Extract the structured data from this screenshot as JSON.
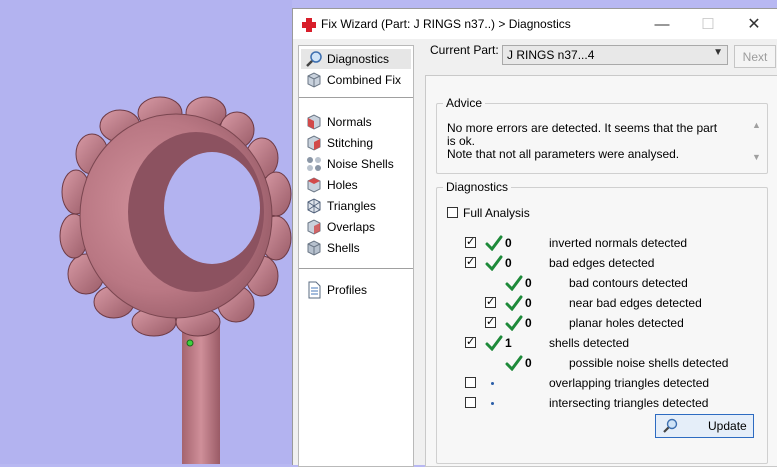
{
  "dialog": {
    "title": "Fix Wizard (Part: J RINGS n37..) > Diagnostics",
    "controls": {
      "minimize": "—",
      "maximize": "☐",
      "close": "✕"
    }
  },
  "nav": {
    "items": [
      {
        "label": "Diagnostics",
        "icon": "magnifier-icon",
        "selected": true
      },
      {
        "label": "Combined Fix",
        "icon": "cube-icon"
      },
      {
        "label": "Normals",
        "icon": "normals-cube-icon"
      },
      {
        "label": "Stitching",
        "icon": "stitching-cube-icon"
      },
      {
        "label": "Noise Shells",
        "icon": "noise-shells-icon"
      },
      {
        "label": "Holes",
        "icon": "holes-cube-icon"
      },
      {
        "label": "Triangles",
        "icon": "triangles-icon"
      },
      {
        "label": "Overlaps",
        "icon": "overlaps-cube-icon"
      },
      {
        "label": "Shells",
        "icon": "shells-cube-icon"
      },
      {
        "label": "Profiles",
        "icon": "document-icon"
      }
    ]
  },
  "current_part": {
    "label": "Current Part:",
    "value": "J RINGS n37...4"
  },
  "next_label": "Next",
  "advice": {
    "legend": "Advice",
    "line1": "No more errors are detected. It seems that the part is ok.",
    "line2": "Note that not all parameters were analysed."
  },
  "diagnostics": {
    "legend": "Diagnostics",
    "full_analysis_label": "Full Analysis",
    "full_analysis_checked": false,
    "rows": [
      {
        "checkbox": true,
        "checked": true,
        "status": "ok",
        "count": "0",
        "label": "inverted normals detected"
      },
      {
        "checkbox": true,
        "checked": true,
        "status": "ok",
        "count": "0",
        "label": "bad edges detected"
      },
      {
        "checkbox": false,
        "status": "ok",
        "count": "0",
        "label": "bad contours detected"
      },
      {
        "checkbox": true,
        "checked": true,
        "status": "ok",
        "count": "0",
        "label": "near bad edges detected"
      },
      {
        "checkbox": true,
        "checked": true,
        "status": "ok",
        "count": "0",
        "label": "planar holes detected"
      },
      {
        "checkbox": true,
        "checked": true,
        "status": "ok",
        "count": "1",
        "label": "shells detected"
      },
      {
        "checkbox": false,
        "status": "ok",
        "count": "0",
        "label": "possible noise shells detected"
      },
      {
        "checkbox": true,
        "checked": false,
        "status": "not-run",
        "count": "",
        "label": "overlapping triangles detected"
      },
      {
        "checkbox": true,
        "checked": false,
        "status": "not-run",
        "count": "",
        "label": "intersecting triangles detected"
      }
    ]
  },
  "update_label": "Update",
  "colors": {
    "model": "#c07e8a",
    "background": "#b3b3f0",
    "check_green": "#1e8a3a",
    "accent": "#2d6bc1"
  }
}
